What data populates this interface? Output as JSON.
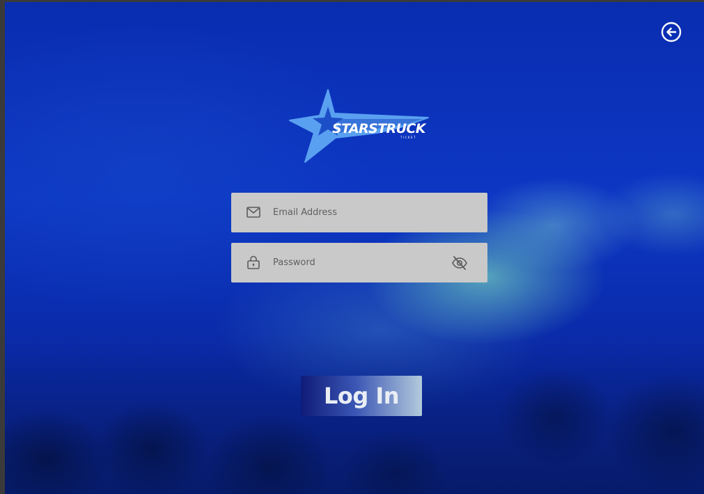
{
  "brand": {
    "name": "STARSTRUCK",
    "subtitle": "TICKET",
    "accent_color": "#5aa0f0",
    "star_inner_color": "#1c4fc7"
  },
  "header": {
    "back_icon": "arrow-left-circle-icon"
  },
  "form": {
    "email": {
      "icon": "envelope-icon",
      "placeholder": "Email Address",
      "value": ""
    },
    "password": {
      "icon": "lock-icon",
      "placeholder": "Password",
      "value": "",
      "toggle_icon": "eye-slash-icon"
    },
    "submit_label": "Log In"
  },
  "colors": {
    "background": "#0a2fae",
    "field_background": "#c9c9c9",
    "icon_color": "#5a5a5a",
    "button_gradient_start": "#101b78",
    "button_gradient_end": "#b3cadc"
  }
}
